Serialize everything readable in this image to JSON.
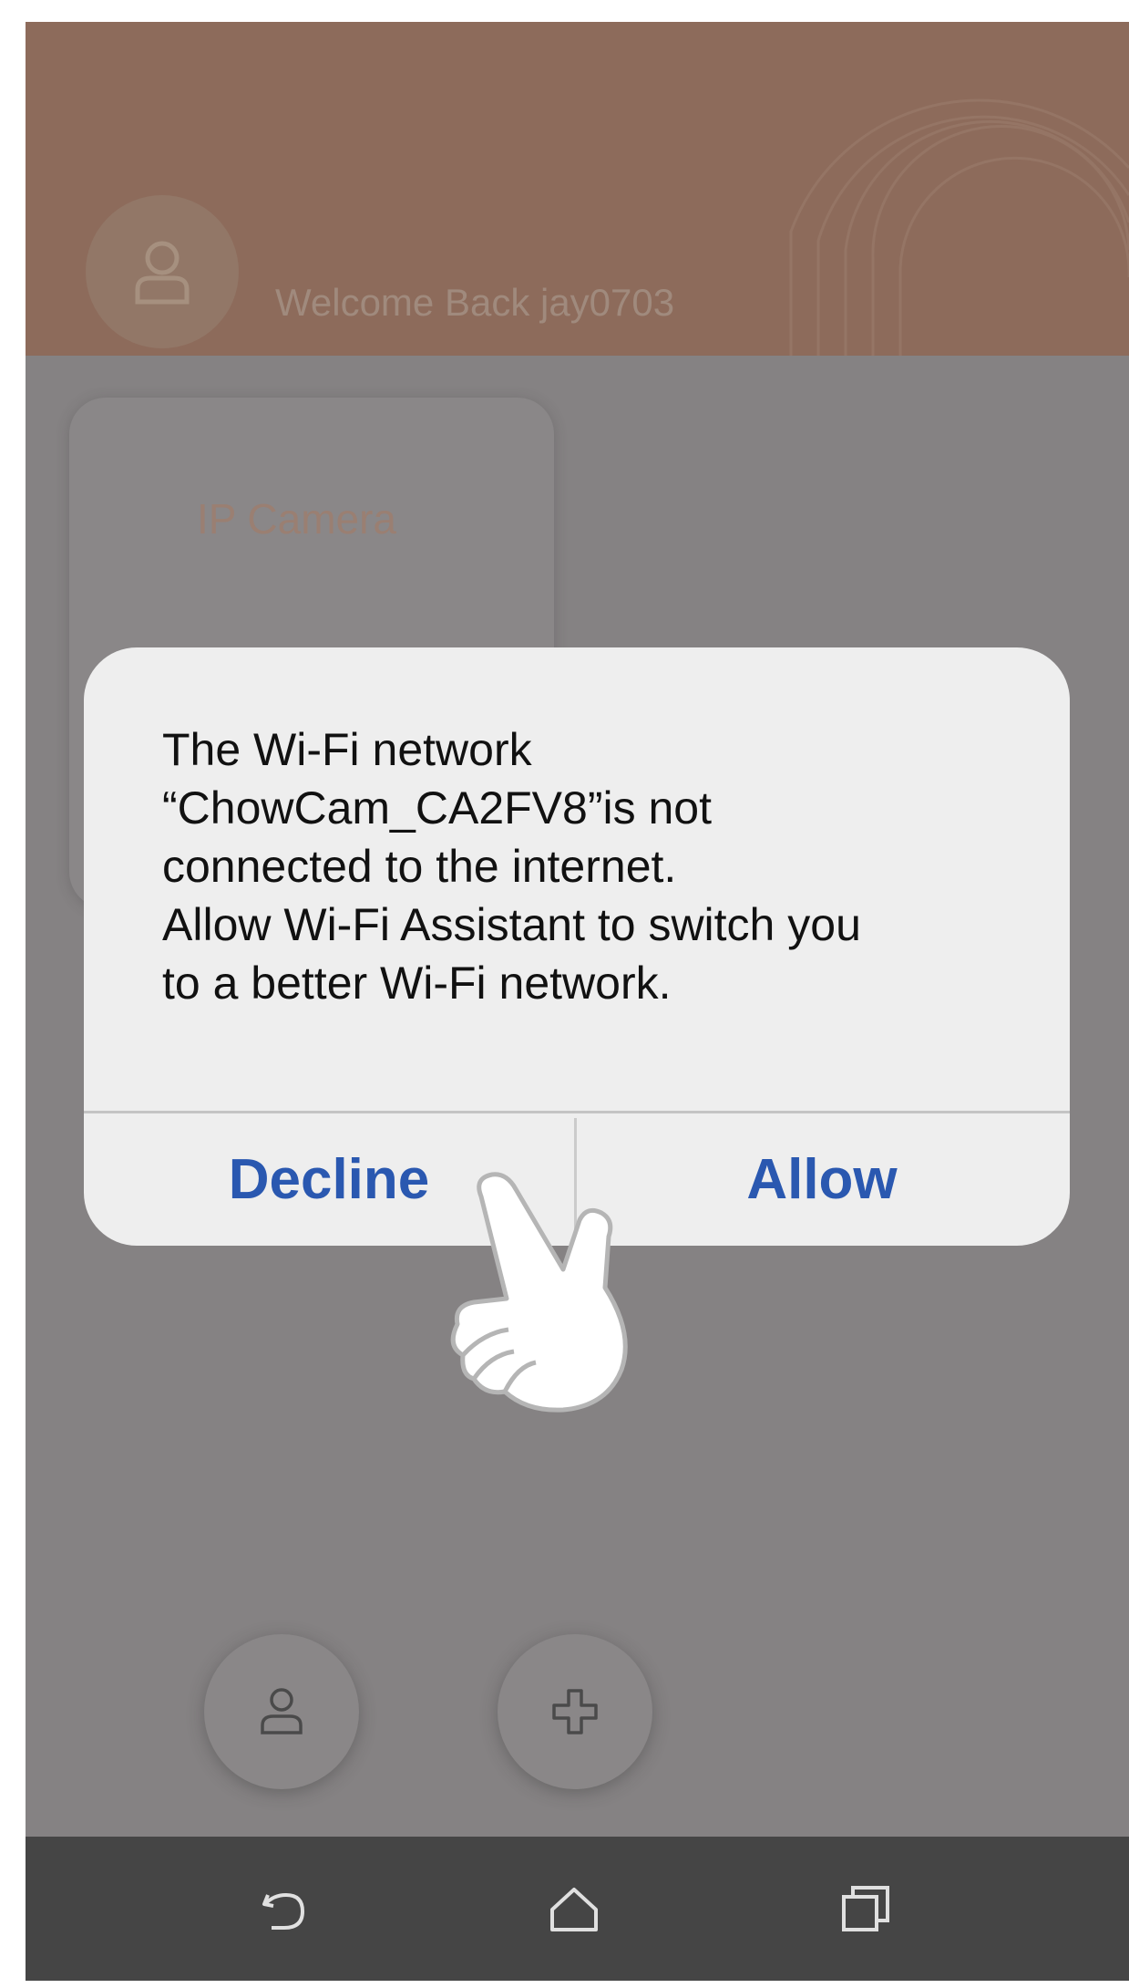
{
  "header": {
    "welcome_text": "Welcome Back jay0703"
  },
  "devices": [
    {
      "name": "IP Camera"
    }
  ],
  "dialog": {
    "message_lines": [
      "The Wi-Fi network",
      "“ChowCam_CA2FV8”is not",
      "connected to the internet.",
      "Allow Wi-Fi Assistant to switch you",
      "to a better Wi-Fi network."
    ],
    "decline_label": "Decline",
    "allow_label": "Allow",
    "button_color": "#2a58b0"
  },
  "bottom_actions": {
    "icons": [
      "user-icon",
      "plus-icon"
    ]
  },
  "nav_bar": {
    "icons": [
      "back-icon",
      "home-icon",
      "recent-apps-icon"
    ]
  },
  "colors": {
    "header": "#8d6b5b",
    "overlay_body": "#858283",
    "nav_bar": "#454545",
    "dialog_bg": "#eeeeee"
  }
}
